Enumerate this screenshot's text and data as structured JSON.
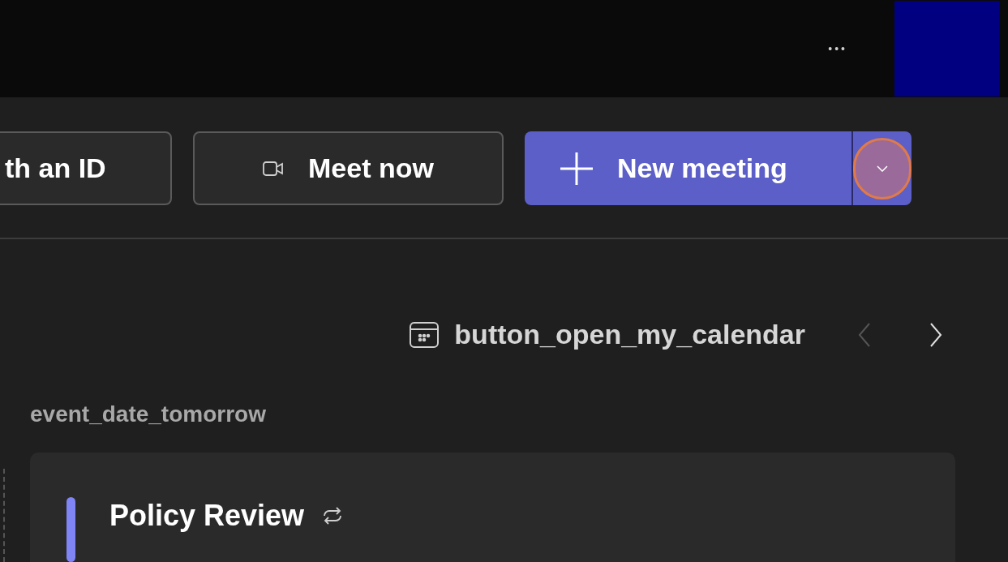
{
  "title_bar": {
    "more": "•••"
  },
  "actions": [
    {
      "kind": "outline",
      "label": "th an ID"
    },
    {
      "kind": "video",
      "label": "Meet now"
    },
    {
      "kind": "primary",
      "label": "New meeting",
      "dropdown_highlighted": true
    }
  ],
  "calendar": {
    "label": "button_open_my_calendar",
    "prev_disabled": true,
    "next_disabled": false
  },
  "date_heading": "event_date_tomorrow",
  "events": [
    {
      "title": "Policy Review",
      "recurring": true,
      "color": "#7f85f5"
    }
  ]
}
